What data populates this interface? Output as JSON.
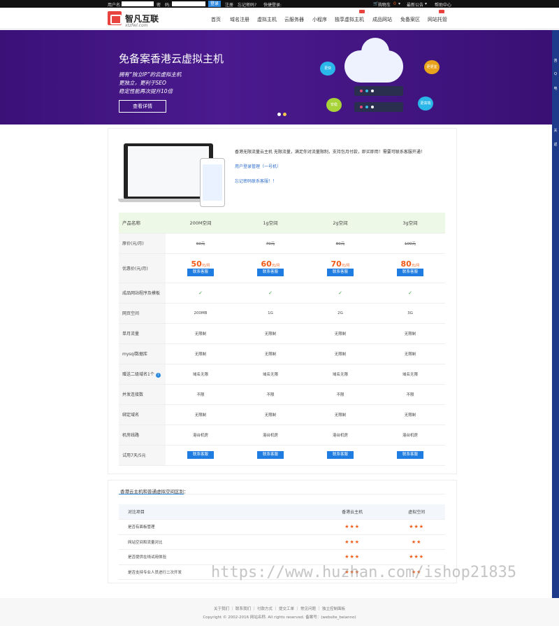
{
  "topbar": {
    "user_label": "用户名:",
    "pwd_label": "密　码:",
    "login": "登录",
    "register": "注册",
    "forgot": "忘记密码?",
    "quick_login": "快捷登录:",
    "cart": "购物车",
    "cart_count": "0",
    "news": "最新公告",
    "help": "帮助中心"
  },
  "logo": {
    "name": "智凡互联",
    "domain": "xtzfwl.com"
  },
  "nav": {
    "items": [
      "首页",
      "域名注册",
      "虚拟主机",
      "云服务器",
      "小程序",
      "独享虚拟主机",
      "成品网站",
      "免备案区",
      "网站托管"
    ]
  },
  "banner": {
    "title": "免备案香港云虚拟主机",
    "line1": "拥有“独立IP”的云虚拟主机",
    "line2": "更独立，更利于SEO",
    "line3": "稳定性能再次提升10倍",
    "button": "查看详情",
    "bubbles": [
      "更快",
      "更便宜",
      "安稳",
      "更高端"
    ]
  },
  "intro": {
    "text": "香港无限流量云主机 无限流量，满足你对流量限制，支持包月付款，即买即用！需要可联系客服开通！",
    "link1": "用户登录管理（一号机）",
    "link2": "忘记密码联系客服！！"
  },
  "prices": {
    "label_product": "产品名称",
    "products": [
      "200M空间",
      "1g空间",
      "2g空间",
      "3g空间"
    ],
    "label_original": "原价(元/月)",
    "original": [
      "60元",
      "70元",
      "80元",
      "100元"
    ],
    "label_discount": "优惠价(元/月)",
    "discount": [
      "50",
      "60",
      "70",
      "80"
    ],
    "unit": "元/月",
    "contact": "联系客服",
    "label_template": "成品网站程序及模板",
    "label_space": "网页空间",
    "space": [
      "200MB",
      "1G",
      "2G",
      "3G"
    ],
    "label_traffic": "单月流量",
    "traffic": "无限制",
    "label_mysql": "mysql数据库",
    "mysql": "无限制",
    "label_subdomain": "赠送二级域名1个",
    "subdomain": "域名无限",
    "label_concurrency": "并发连接数",
    "concurrency": "不限",
    "label_bind": "绑定域名",
    "bind": "无限制",
    "label_room": "机房线路",
    "room": "港台机房",
    "label_trial": "试用7天/5元"
  },
  "compare": {
    "title": "香港云主机和普通虚拟空间区别：",
    "col_item": "对比项目",
    "col_cloud": "香港云主机",
    "col_virtual": "虚拟空间",
    "rows": [
      {
        "item": "是否有面板管理",
        "cloud": "★★★",
        "virtual": "★★★"
      },
      {
        "item": "网站空间和流量对比",
        "cloud": "★★★",
        "virtual": "★★"
      },
      {
        "item": "是否提供在线试用体验",
        "cloud": "★★★",
        "virtual": "★★★"
      },
      {
        "item": "是否支持专业人员进行二次开发",
        "cloud": "★★★",
        "virtual": "★★"
      }
    ]
  },
  "footer": {
    "links": "关于我们 ｜ 联系我们 ｜ 付款方式 ｜ 提交工单 ｜ 常见问题 ｜ 独立控制面板",
    "copyright": "Copyright © 2002-2016 网站名称. All rights reserved.   备案号：(website_beianno)"
  },
  "sidebar": [
    "咨",
    "Q",
    "电",
    "关",
    "返"
  ],
  "watermark": "https://www.huzhan.com/ishop21835",
  "colors": {
    "accent": "#2d8ae0",
    "price": "#f25a15",
    "banner": "#4a1a8e",
    "brand": "#e8433e"
  }
}
